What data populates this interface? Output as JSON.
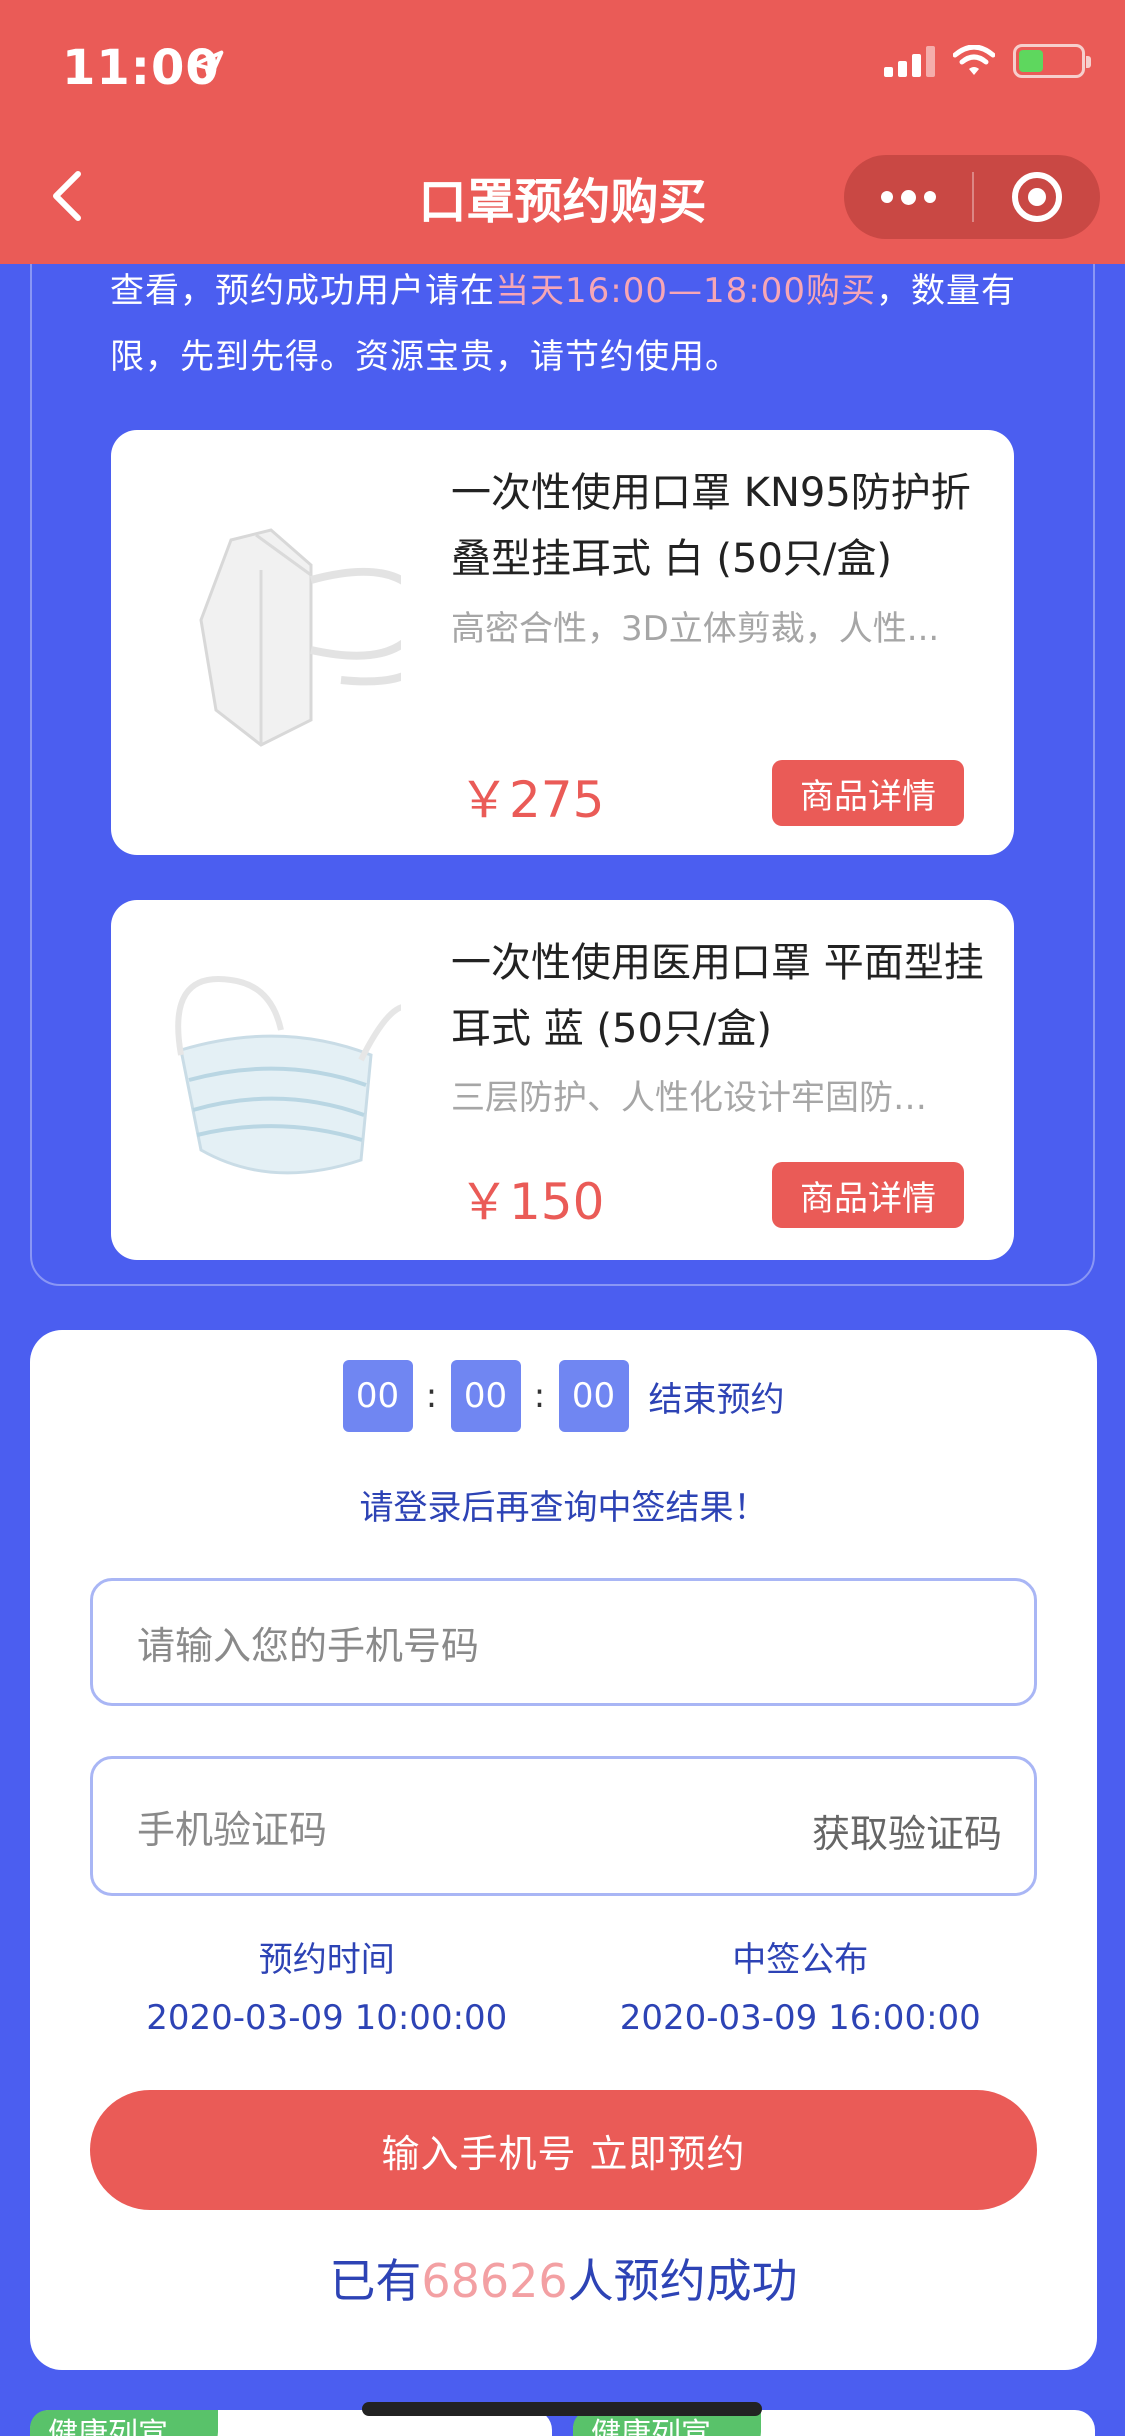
{
  "status_bar": {
    "time": "11:00"
  },
  "nav": {
    "title": "口罩预约购买"
  },
  "notice": {
    "prefix": "查看，预约成功用户请在",
    "highlight": "当天16:00—18:00购买",
    "suffix": "，数量有限，先到先得。资源宝贵，请节约使用。"
  },
  "products": [
    {
      "name": "一次性使用口罩 KN95防护折叠型挂耳式 白 (50只/盒)",
      "desc": "高密合性，3D立体剪裁，人性...",
      "price": "￥275",
      "button": "商品详情"
    },
    {
      "name": "一次性使用医用口罩 平面型挂耳式 蓝 (50只/盒)",
      "desc": "三层防护、人性化设计牢固防…",
      "price": "￥150",
      "button": "商品详情"
    }
  ],
  "countdown": {
    "h": "00",
    "m": "00",
    "s": "00",
    "sep": ":",
    "label": "结束预约"
  },
  "login_hint": "请登录后再查询中签结果！",
  "form": {
    "phone_placeholder": "请输入您的手机号码",
    "code_placeholder": "手机验证码",
    "get_code": "获取验证码"
  },
  "times": {
    "reserve_label": "预约时间",
    "reserve_value": "2020-03-09 10:00:00",
    "announce_label": "中签公布",
    "announce_value": "2020-03-09 16:00:00"
  },
  "reserve_button": "输入手机号 立即预约",
  "success": {
    "prefix": "已有",
    "count": "68626",
    "suffix": "人预约成功"
  },
  "bottom_tags": [
    "健康列宣",
    "健康列宣"
  ]
}
